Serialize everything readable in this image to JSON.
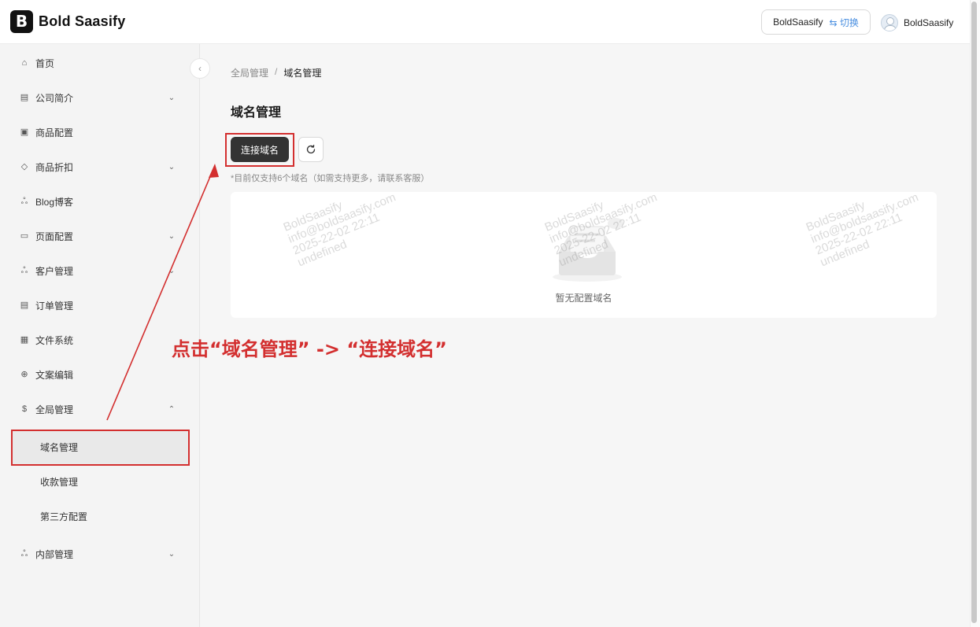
{
  "header": {
    "brand_letter": "B",
    "brand_name": "Bold Saasify",
    "project_name": "BoldSaasify",
    "switch_label": "⇆ 切换",
    "user_name": "BoldSaasify"
  },
  "sidebar": {
    "items": [
      {
        "label": "首页",
        "icon": "home-icon"
      },
      {
        "label": "公司简介",
        "icon": "building-icon"
      },
      {
        "label": "商品配置",
        "icon": "box-icon"
      },
      {
        "label": "商品折扣",
        "icon": "tag-icon"
      },
      {
        "label": "Blog博客",
        "icon": "users-icon"
      },
      {
        "label": "页面配置",
        "icon": "monitor-icon"
      },
      {
        "label": "客户管理",
        "icon": "users-icon"
      },
      {
        "label": "订单管理",
        "icon": "document-icon"
      },
      {
        "label": "文件系统",
        "icon": "file-icon"
      },
      {
        "label": "文案编辑",
        "icon": "globe-icon"
      },
      {
        "label": "全局管理",
        "icon": "dollar-circle-icon"
      },
      {
        "label": "内部管理",
        "icon": "users-icon"
      }
    ],
    "sub_items": [
      "域名管理",
      "收款管理",
      "第三方配置"
    ]
  },
  "main": {
    "breadcrumb": [
      "全局管理",
      "域名管理"
    ],
    "breadcrumb_sep": "/",
    "title": "域名管理",
    "connect_button": "连接域名",
    "note": "*目前仅支持6个域名（如需支持更多，请联系客服）",
    "empty_text": "暂无配置域名"
  },
  "watermark": {
    "line1": "BoldSaasify",
    "line2": "info@boldsaasify.com",
    "line3": "2025-22-02 22:11",
    "line4": "undefined"
  },
  "annotation": {
    "text": "点击“域名管理” -> “连接域名”",
    "color": "#d32f2f"
  }
}
